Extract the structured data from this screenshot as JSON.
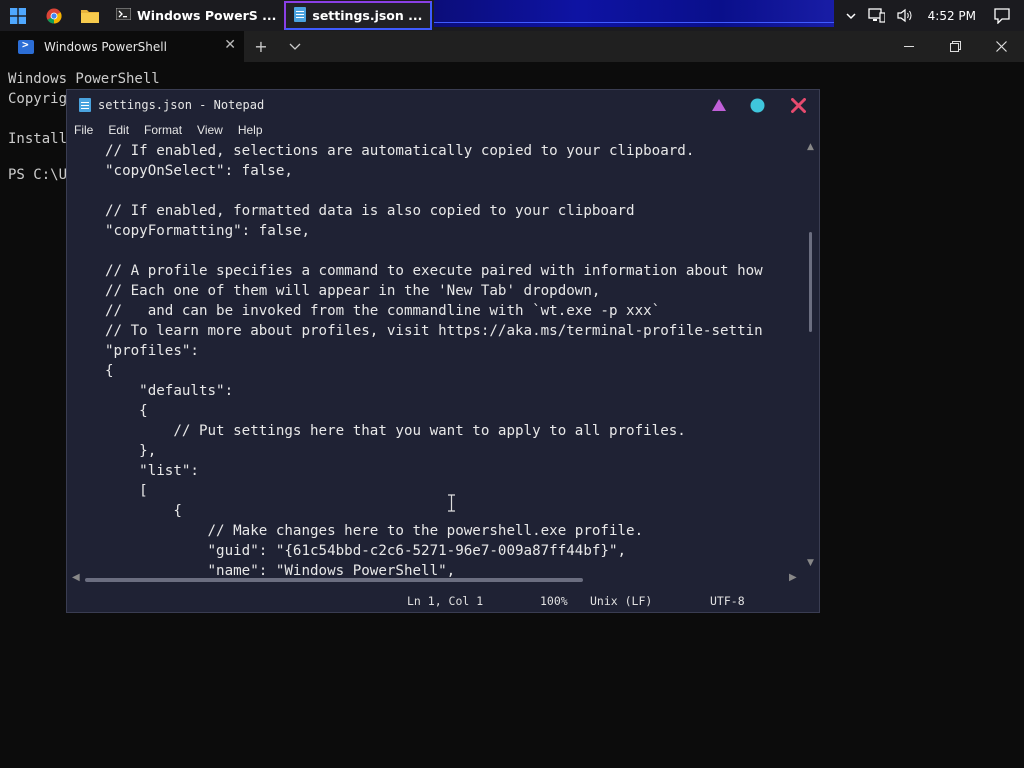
{
  "taskbar": {
    "apps": [
      {
        "label": "Windows PowerS ..."
      },
      {
        "label": "settings.json  ..."
      }
    ],
    "tray": {
      "time": "4:52 PM"
    }
  },
  "terminal": {
    "tab_title": "Windows PowerShell",
    "lines": [
      "Windows PowerShell",
      "Copyrig",
      "",
      "Install",
      "",
      "PS C:\\U"
    ]
  },
  "notepad": {
    "title": "settings.json - Notepad",
    "menu": [
      "File",
      "Edit",
      "Format",
      "View",
      "Help"
    ],
    "code_lines": [
      "// If enabled, selections are automatically copied to your clipboard.",
      "\"copyOnSelect\": false,",
      "",
      "// If enabled, formatted data is also copied to your clipboard",
      "\"copyFormatting\": false,",
      "",
      "// A profile specifies a command to execute paired with information about how",
      "// Each one of them will appear in the 'New Tab' dropdown,",
      "//   and can be invoked from the commandline with `wt.exe -p xxx`",
      "// To learn more about profiles, visit https://aka.ms/terminal-profile-settin",
      "\"profiles\":",
      "{",
      "    \"defaults\":",
      "    {",
      "        // Put settings here that you want to apply to all profiles.",
      "    },",
      "    \"list\":",
      "    [",
      "        {",
      "            // Make changes here to the powershell.exe profile.",
      "            \"guid\": \"{61c54bbd-c2c6-5271-96e7-009a87ff44bf}\",",
      "            \"name\": \"Windows PowerShell\","
    ],
    "status": {
      "position": "Ln 1, Col 1",
      "zoom": "100%",
      "line_ending": "Unix (LF)",
      "encoding": "UTF-8"
    },
    "colors": {
      "min": "#c060d8",
      "max": "#3fc6dc",
      "close": "#e64a6e"
    }
  }
}
